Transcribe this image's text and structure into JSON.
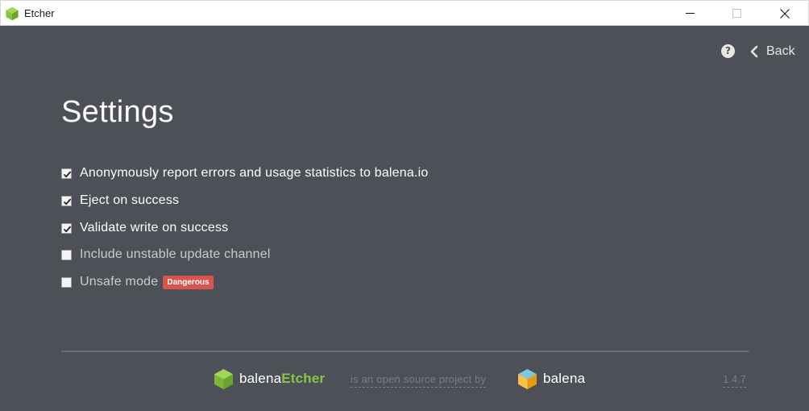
{
  "window": {
    "title": "Etcher",
    "controls": [
      "minimize-icon",
      "maximize-icon",
      "close-icon"
    ]
  },
  "header": {
    "help_icon": "question-circle-icon",
    "back_label": "Back",
    "back_icon": "chevron-left-icon"
  },
  "page": {
    "title": "Settings"
  },
  "settings": [
    {
      "label": "Anonymously report errors and usage statistics to balena.io",
      "checked": true
    },
    {
      "label": "Eject on success",
      "checked": true
    },
    {
      "label": "Validate write on success",
      "checked": true
    },
    {
      "label": "Include unstable update channel",
      "checked": false
    },
    {
      "label": "Unsafe mode",
      "checked": false,
      "badge": "Dangerous"
    }
  ],
  "footer": {
    "etcher_brand_prefix": "balena",
    "etcher_brand_suffix": "Etcher",
    "oss_text": "is an open source project by",
    "balena_brand": "balena",
    "version": "1.4.7"
  },
  "colors": {
    "background": "#4d5057",
    "accent_green": "#8bc34a",
    "danger": "#d9534f",
    "titlebar": "#ffffff"
  }
}
